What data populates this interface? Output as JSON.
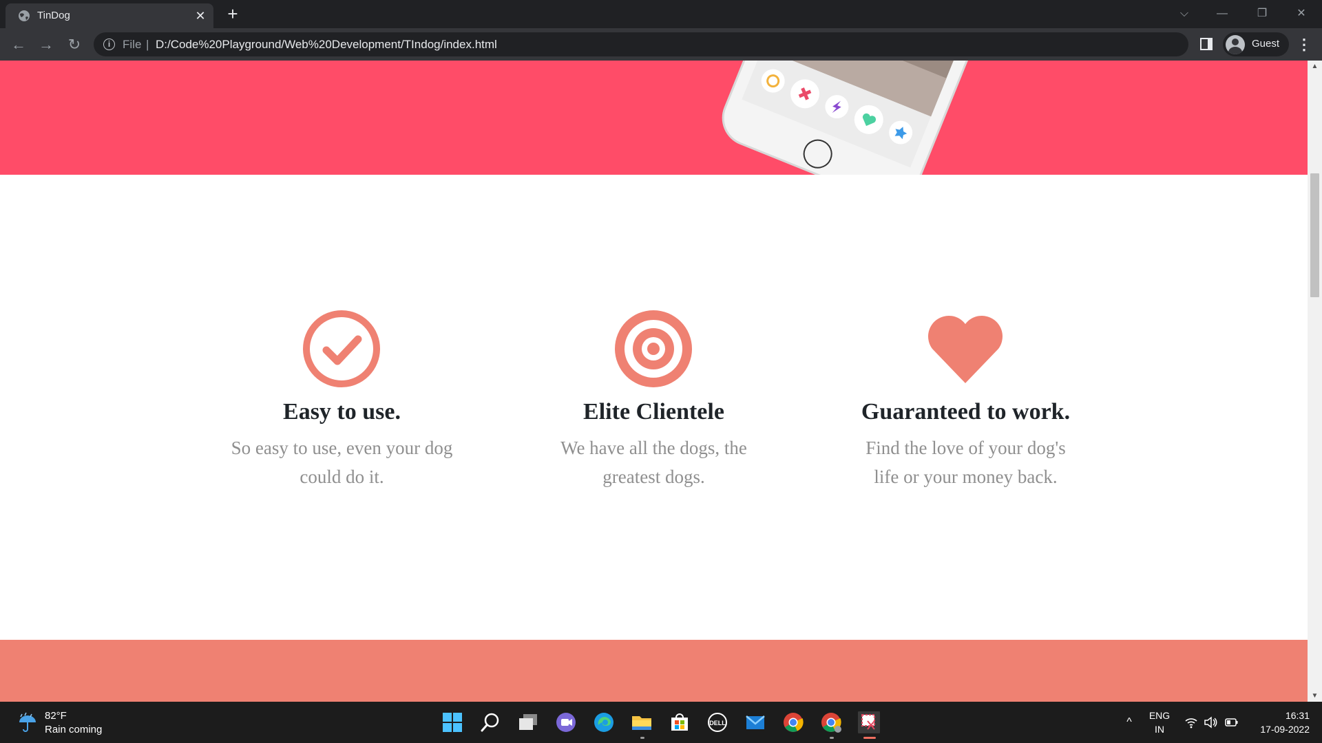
{
  "browser": {
    "tab_title": "TinDog",
    "tab_close": "✕",
    "new_tab": "+",
    "window_controls": [
      "⌵",
      "—",
      "❐",
      "✕"
    ],
    "address_scheme": "File",
    "address_separator": "|",
    "address_url": "D:/Code%20Playground/Web%20Development/TIndog/index.html",
    "profile_label": "Guest",
    "menu": "⋮",
    "nav": {
      "back": "←",
      "forward": "→",
      "reload": "↻"
    }
  },
  "page": {
    "hero_color": "#ff4c68",
    "accent_color": "#ef8172",
    "features": [
      {
        "icon": "check-circle-icon",
        "title": "Easy to use.",
        "description": "So easy to use, even your dog could do it."
      },
      {
        "icon": "bullseye-icon",
        "title": "Elite Clientele",
        "description": "We have all the dogs, the greatest dogs."
      },
      {
        "icon": "heart-icon",
        "title": "Guaranteed to work.",
        "description": "Find the love of your dog's life or your money back."
      }
    ],
    "testimonials_color": "#ef8172"
  },
  "scrollbar": {
    "up": "▲",
    "down": "▼"
  },
  "taskbar": {
    "weather_temp": "82°F",
    "weather_text": "Rain coming",
    "apps": [
      "windows-start-icon",
      "search-icon",
      "task-view-icon",
      "teams-chat-icon",
      "edge-icon",
      "file-explorer-icon",
      "microsoft-store-icon",
      "dell-icon",
      "mail-icon",
      "chrome-icon",
      "chrome-guest-icon",
      "snipping-tool-icon"
    ],
    "tray_chevron": "^",
    "language_line1": "ENG",
    "language_line2": "IN",
    "time": "16:31",
    "date": "17-09-2022"
  }
}
